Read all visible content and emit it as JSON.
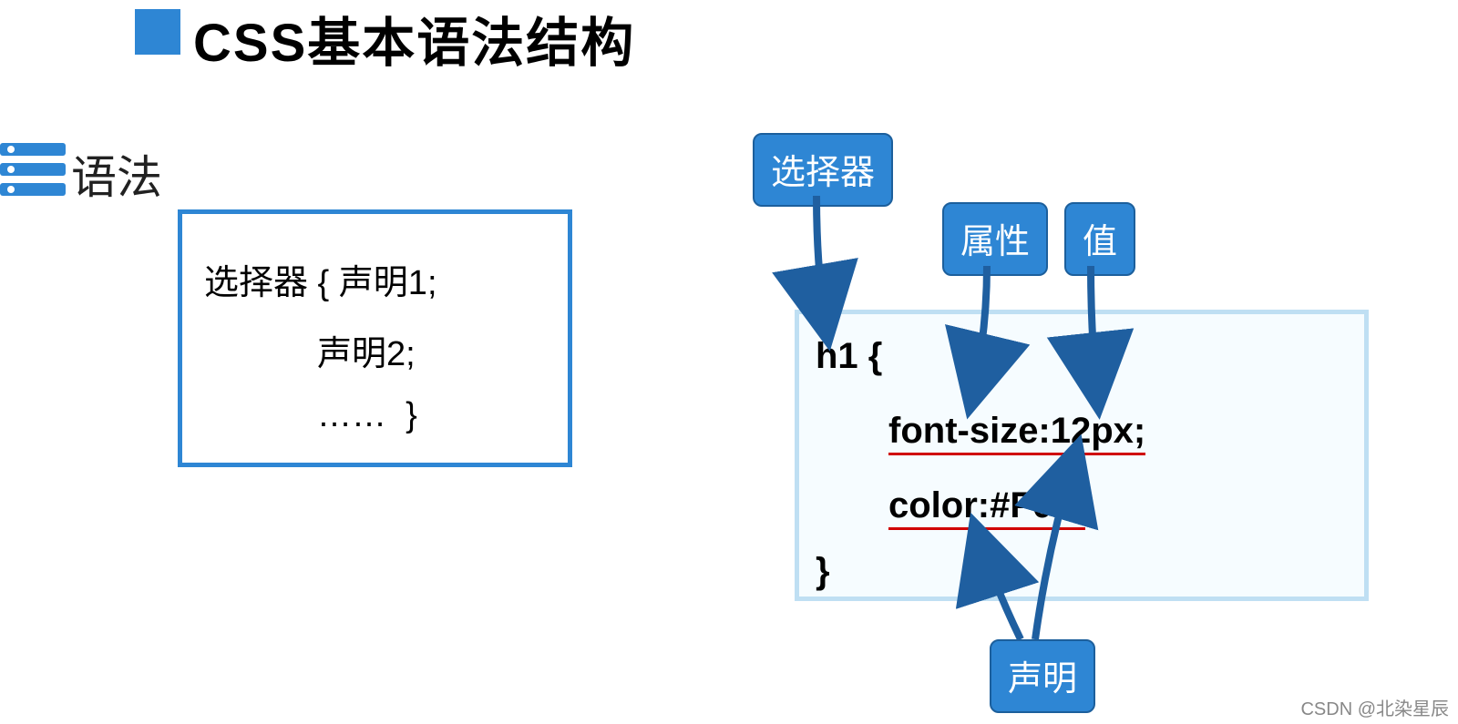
{
  "title": "CSS基本语法结构",
  "sections": {
    "syntax": {
      "heading": "语法",
      "box": {
        "line1": "选择器 { 声明1;",
        "line2": "声明2;",
        "line3": "……  }"
      }
    },
    "example": {
      "code": {
        "line1": "h1 {",
        "line2": "font-size:12px;",
        "line3": "color:#F00;",
        "line4": "}"
      }
    }
  },
  "callouts": {
    "selector": "选择器",
    "property": "属性",
    "value": "值",
    "declaration": "声明"
  },
  "colors": {
    "accent": "#2e86d4",
    "light_border": "#bfdff3",
    "underline": "#d00000"
  },
  "watermark": "CSDN @北染星辰"
}
